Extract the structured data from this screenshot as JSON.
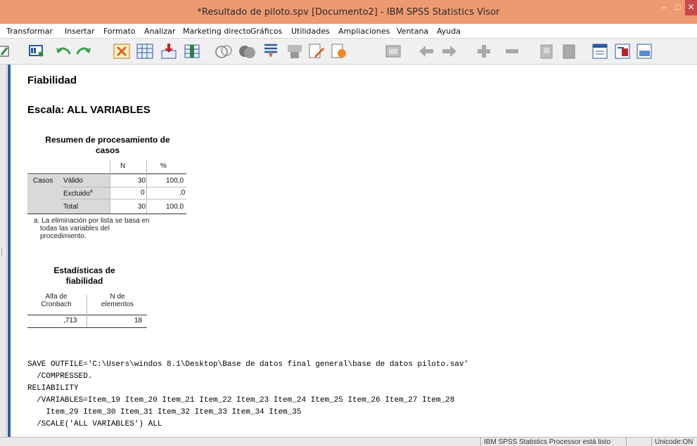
{
  "window": {
    "title": "*Resultado de piloto.spv [Documento2] - IBM SPSS Statistics Visor"
  },
  "menu": [
    "Transformar",
    "Insertar",
    "Formato",
    "Analizar",
    "Marketing directo",
    "Gráficos",
    "Utilidades",
    "Ampliaciones",
    "Ventana",
    "Ayuda"
  ],
  "output": {
    "heading": "Fiabilidad",
    "scale": "Escala: ALL VARIABLES",
    "case_table": {
      "title_line1": "Resumen de procesamiento de",
      "title_line2": "casos",
      "col_n": "N",
      "col_pct": "%",
      "group": "Casos",
      "rows": [
        {
          "label": "Válido",
          "n": "30",
          "pct": "100,0"
        },
        {
          "label": "Excluido",
          "sup": "a",
          "n": "0",
          "pct": ",0"
        },
        {
          "label": "Total",
          "n": "30",
          "pct": "100,0"
        }
      ],
      "footnote": [
        "a. La eliminación por lista se basa en",
        "todas las variables del",
        "procedimiento."
      ]
    },
    "stats_table": {
      "title_line1": "Estadísticas de",
      "title_line2": "fiabilidad",
      "col1_line1": "Alfa de",
      "col1_line2": "Cronbach",
      "col2_line1": "N de",
      "col2_line2": "elementos",
      "alpha": ",713",
      "n_items": "18"
    },
    "syntax": [
      "SAVE OUTFILE='C:\\Users\\windos 8.1\\Desktop\\Base de datos final general\\base de datos piloto.sav'",
      "  /COMPRESSED.",
      "RELIABILITY",
      "  /VARIABLES=Item_19 Item_20 Item_21 Item_22 Item_23 Item_24 Item_25 Item_26 Item_27 Item_28",
      "    Item_29 Item_30 Item_31 Item_32 Item_33 Item_34 Item_35",
      "  /SCALE('ALL VARIABLES') ALL"
    ]
  },
  "status": {
    "processor": "IBM SPSS Statistics Processor está listo",
    "unicode": "Unicode:ON"
  },
  "colors": {
    "titlebar": "#ee9a71",
    "close": "#c8484b",
    "outline_bar": "#2f5ea8"
  }
}
